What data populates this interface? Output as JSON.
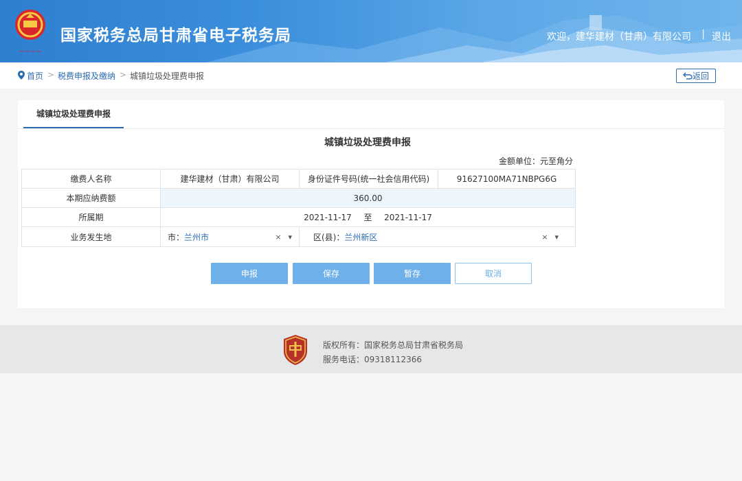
{
  "header": {
    "site_title": "国家税务总局甘肃省电子税务局",
    "welcome": "欢迎，建华建材（甘肃）有限公司",
    "separator": "|",
    "logout": "退出"
  },
  "breadcrumb": {
    "home": "首页",
    "gt": ">",
    "section": "税费申报及缴纳",
    "current": "城镇垃圾处理费申报",
    "back": "返回"
  },
  "form": {
    "tab": "城镇垃圾处理费申报",
    "title": "城镇垃圾处理费申报",
    "unit": "金额单位：元至角分",
    "payer_label": "缴费人名称",
    "payer_value": "建华建材（甘肃）有限公司",
    "id_label": "身份证件号码(统一社会信用代码)",
    "id_value": "91627100MA71NBPG6G",
    "amount_label": "本期应纳费额",
    "amount_value": "360.00",
    "period_label": "所属期",
    "period_start": "2021-11-17",
    "period_to": "至",
    "period_end": "2021-11-17",
    "location_label": "业务发生地",
    "city_prefix": "市：",
    "city_value": "兰州市",
    "district_prefix": "区(县)：",
    "district_value": "兰州新区",
    "clear": "×",
    "dropdown": "▾"
  },
  "buttons": {
    "submit": "申报",
    "save": "保存",
    "draft": "暂存",
    "cancel": "取消"
  },
  "footer": {
    "copyright": "版权所有：国家税务总局甘肃省税务局",
    "phone": "服务电话：09318112366"
  },
  "colors": {
    "header_blue": "#3c8fdc",
    "link_blue": "#2b6cb0",
    "button_blue": "#6db0ea"
  }
}
